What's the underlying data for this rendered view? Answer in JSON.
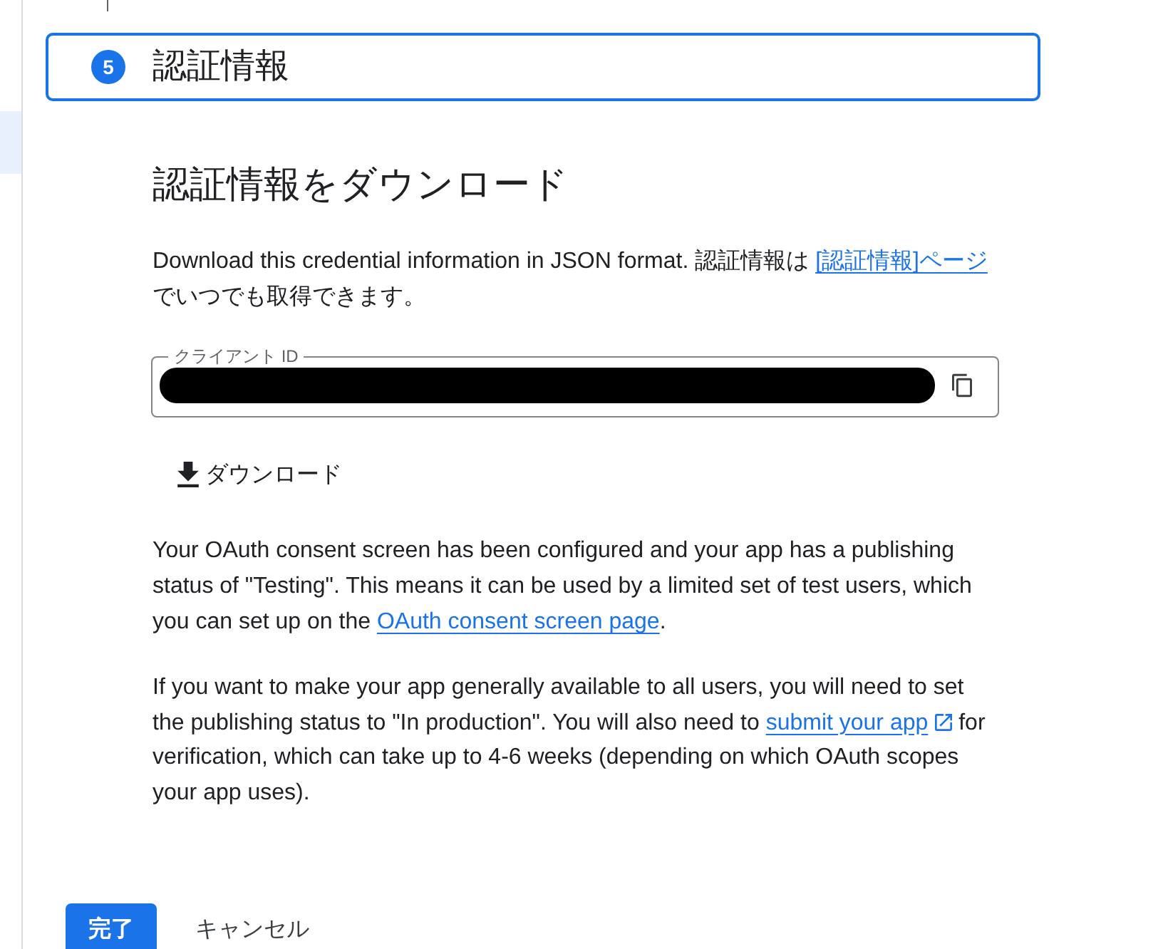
{
  "sidebar": {
    "items": [
      {
        "selected": true
      }
    ]
  },
  "step": {
    "number": "5",
    "title": "認証情報",
    "active": true
  },
  "section": {
    "heading": "認証情報をダウンロード",
    "description": [
      {
        "kind": "text",
        "text": "Download this credential information in JSON format. 認証情報は "
      },
      {
        "kind": "link",
        "text": "[認証情報]ページ",
        "external": false
      },
      {
        "kind": "text",
        "text": "でいつでも取得できます。"
      }
    ],
    "client_id_field": {
      "label": "クライアント ID",
      "redacted": true
    },
    "download_button": "ダウンロード",
    "notes": [
      [
        {
          "kind": "text",
          "text": "Your OAuth consent screen has been configured and your app has a publishing status of \"Testing\". This means it can be used by a limited set of test users, which you can set up on the "
        },
        {
          "kind": "link",
          "text": "OAuth consent screen page",
          "external": false
        },
        {
          "kind": "text",
          "text": "."
        }
      ],
      [
        {
          "kind": "text",
          "text": "If you want to make your app generally available to all users, you will need to set the publishing status to \"In production\". You will also need to "
        },
        {
          "kind": "link",
          "text": "submit your app",
          "external": true
        },
        {
          "kind": "text",
          "text": " for verification, which can take up to 4-6 weeks (depending on which OAuth scopes your app uses)."
        }
      ]
    ]
  },
  "actions": [
    {
      "kind": "primary",
      "label": "完了"
    },
    {
      "kind": "text",
      "label": "キャンセル"
    }
  ]
}
